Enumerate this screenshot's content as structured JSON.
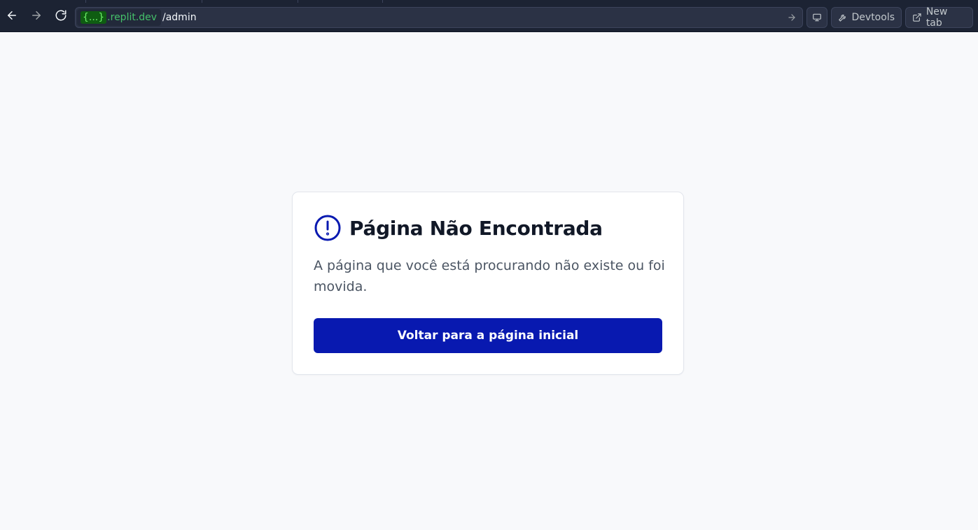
{
  "browser": {
    "url_host_prefix": "{...}",
    "url_host_suffix": ".replit.dev",
    "url_path": "/admin",
    "devtools_label": "Devtools",
    "new_tab_label": "New tab"
  },
  "card": {
    "title": "Página Não Encontrada",
    "description": "A página que você está procurando não existe ou foi movida.",
    "button_label": "Voltar para a página inicial"
  },
  "icons": {
    "back": "arrow-left-icon",
    "forward": "arrow-right-icon",
    "reload": "reload-icon",
    "go": "arrow-right-icon",
    "preview": "monitor-icon",
    "devtools": "wrench-icon",
    "new_tab": "external-link-icon",
    "alert": "alert-circle-icon"
  },
  "colors": {
    "toolbar_bg": "#1c2333",
    "host_text": "#45c06a",
    "primary_button": "#0819b0",
    "alert_icon": "#0819b0",
    "page_bg": "#f8f9fb"
  }
}
